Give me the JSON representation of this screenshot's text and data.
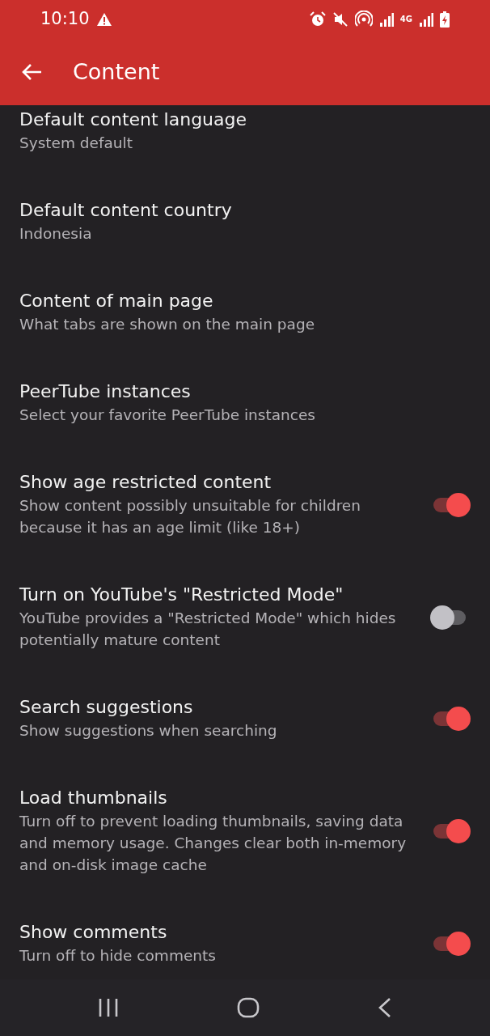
{
  "status_bar": {
    "time": "10:10",
    "network": "4G"
  },
  "toolbar": {
    "title": "Content"
  },
  "settings": [
    {
      "kind": "link",
      "title": "Default content language",
      "summary": "System default"
    },
    {
      "kind": "link",
      "title": "Default content country",
      "summary": "Indonesia"
    },
    {
      "kind": "link",
      "title": "Content of main page",
      "summary": "What tabs are shown on the main page"
    },
    {
      "kind": "link",
      "title": "PeerTube instances",
      "summary": "Select your favorite PeerTube instances"
    },
    {
      "kind": "switch",
      "title": "Show age restricted content",
      "summary": "Show content possibly unsuitable for children because it has an age limit (like 18+)",
      "on": true
    },
    {
      "kind": "switch",
      "title": "Turn on YouTube's \"Restricted Mode\"",
      "summary": "YouTube provides a \"Restricted Mode\" which hides potentially mature content",
      "on": false
    },
    {
      "kind": "switch",
      "title": "Search suggestions",
      "summary": "Show suggestions when searching",
      "on": true
    },
    {
      "kind": "switch",
      "title": "Load thumbnails",
      "summary": "Turn off to prevent loading thumbnails, saving data and memory usage. Changes clear both in-memory and on-disk image cache",
      "on": true
    },
    {
      "kind": "switch",
      "title": "Show comments",
      "summary": "Turn off to hide comments",
      "on": true
    }
  ]
}
